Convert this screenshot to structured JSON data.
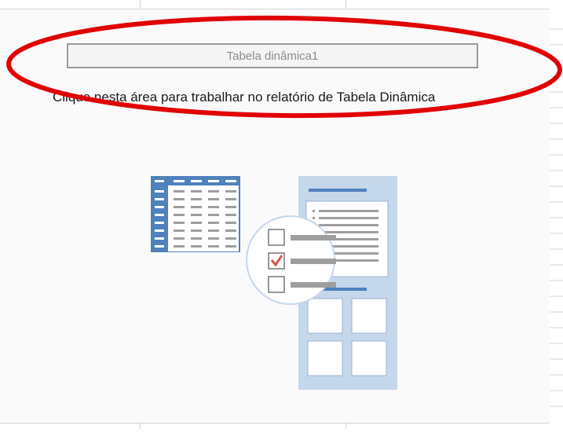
{
  "pivot": {
    "title": "Tabela dinâmica1",
    "instruction": "Clique nesta área para trabalhar no relatório de Tabela Dinâmica"
  },
  "colors": {
    "placeholder_background": "#fafafa",
    "illustration_blue": "#4f81bd",
    "illustration_light_blue": "#c5d7ea",
    "checkmark": "#d9534f",
    "annotation_ellipse": "#e00000"
  },
  "field_list_checkboxes": [
    {
      "checked": false
    },
    {
      "checked": true
    },
    {
      "checked": false
    }
  ]
}
